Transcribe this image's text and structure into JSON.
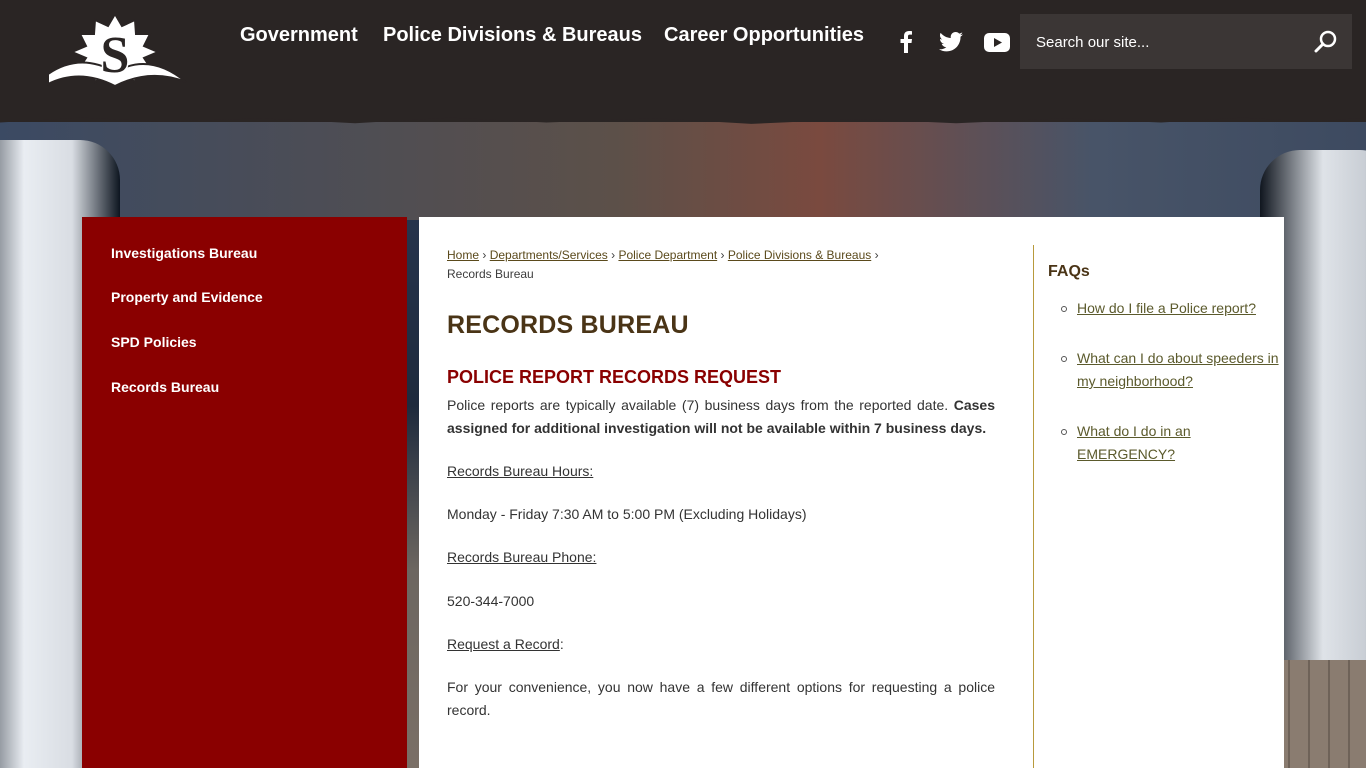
{
  "header": {
    "nav": [
      {
        "label": "Government"
      },
      {
        "label": "Police Divisions & Bureaus"
      },
      {
        "label": "Career Opportunities"
      }
    ],
    "social": [
      "facebook-icon",
      "twitter-icon",
      "youtube-icon"
    ],
    "search": {
      "placeholder": "Search our site..."
    }
  },
  "sidebar": {
    "items": [
      {
        "label": "Investigations Bureau"
      },
      {
        "label": "Property and Evidence"
      },
      {
        "label": "SPD Policies"
      },
      {
        "label": "Records Bureau"
      }
    ]
  },
  "breadcrumb": {
    "links": [
      "Home",
      "Departments/Services",
      "Police Department",
      "Police Divisions & Bureaus"
    ],
    "current": "Records Bureau",
    "separator": "›"
  },
  "main": {
    "title": "RECORDS BUREAU",
    "section_title": "POLICE REPORT RECORDS REQUEST",
    "intro": "Police reports are typically available (7) business days from the reported date.",
    "intro_bold": "Cases assigned for additional investigation will not be available within 7 business days.",
    "hours_label": "Records Bureau Hours:",
    "hours_value": "Monday - Friday 7:30 AM to 5:00 PM (Excluding Holidays)",
    "phone_label": "Records Bureau Phone:",
    "phone_value": "520-344-7000",
    "request_label": "Request a Record",
    "request_suffix": ":",
    "convenience": "For your convenience, you now have a few different options for requesting a police record."
  },
  "faq": {
    "title": "FAQs",
    "items": [
      "How do I file a Police report?",
      "What can I do about speeders in my neighborhood?",
      "What do I do in an EMERGENCY?"
    ]
  },
  "colors": {
    "header_bg": "#2a2524",
    "sidebar_bg": "#8a0000",
    "title_brown": "#4a3416",
    "section_red": "#8a0000",
    "divider_gold": "#b89a3c"
  }
}
